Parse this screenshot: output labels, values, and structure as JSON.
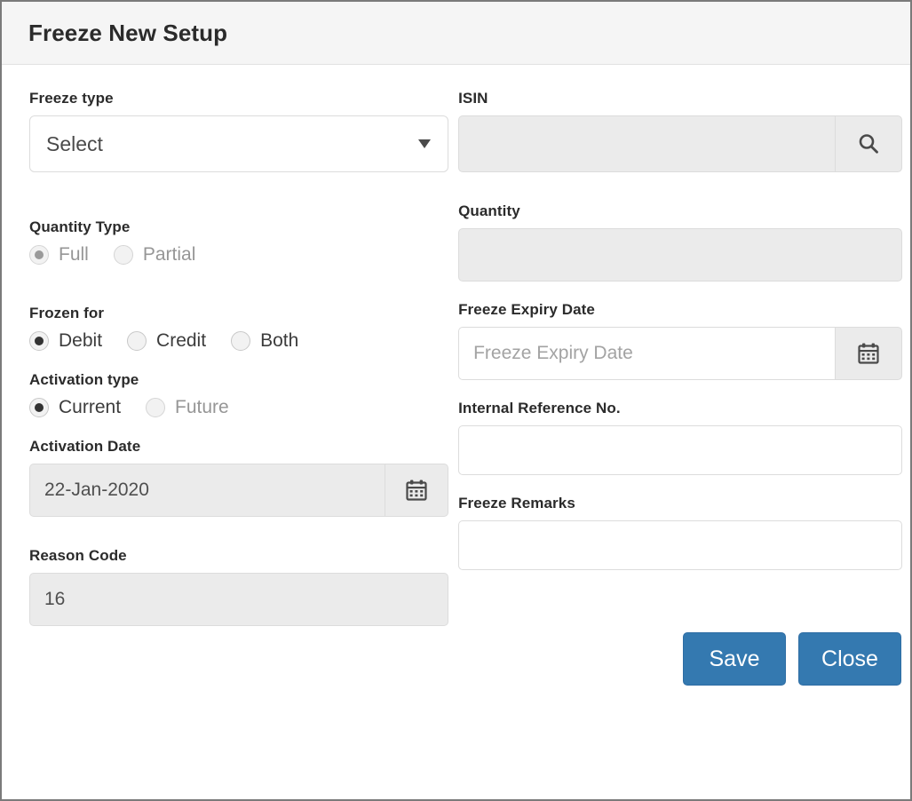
{
  "header": {
    "title": "Freeze New Setup"
  },
  "left_column": {
    "freeze_type": {
      "label": "Freeze type",
      "value": "Select",
      "caret_icon": "chevron-down-icon"
    },
    "quantity_type": {
      "label": "Quantity Type",
      "options": [
        {
          "label": "Full",
          "selected": true,
          "disabled": true
        },
        {
          "label": "Partial",
          "selected": false,
          "disabled": true
        }
      ]
    },
    "frozen_for": {
      "label": "Frozen for",
      "options": [
        {
          "label": "Debit",
          "selected": true,
          "disabled": false
        },
        {
          "label": "Credit",
          "selected": false,
          "disabled": false
        },
        {
          "label": "Both",
          "selected": false,
          "disabled": false
        }
      ]
    },
    "activation_type": {
      "label": "Activation type",
      "options": [
        {
          "label": "Current",
          "selected": true,
          "disabled": false
        },
        {
          "label": "Future",
          "selected": false,
          "disabled": true
        }
      ]
    },
    "activation_date": {
      "label": "Activation Date",
      "value": "22-Jan-2020",
      "button_icon": "calendar-icon",
      "disabled": true
    },
    "reason_code": {
      "label": "Reason Code",
      "value": "16",
      "disabled": true
    }
  },
  "right_column": {
    "isin": {
      "label": "ISIN",
      "value": "",
      "placeholder": "",
      "button_icon": "search-icon",
      "disabled": true
    },
    "quantity": {
      "label": "Quantity",
      "value": "",
      "disabled": true
    },
    "freeze_expiry_date": {
      "label": "Freeze Expiry Date",
      "value": "",
      "placeholder": "Freeze Expiry Date",
      "button_icon": "calendar-icon",
      "disabled": false
    },
    "internal_reference_no": {
      "label": "Internal Reference No.",
      "value": "",
      "placeholder": "",
      "disabled": false
    },
    "freeze_remarks": {
      "label": "Freeze Remarks",
      "value": "",
      "placeholder": "",
      "disabled": false
    },
    "actions": {
      "save_label": "Save",
      "close_label": "Close"
    }
  },
  "colors": {
    "primary_button": "#3479b0",
    "header_background": "#f5f5f5",
    "disabled_field": "#ebebeb",
    "border": "#dcdcdc"
  }
}
